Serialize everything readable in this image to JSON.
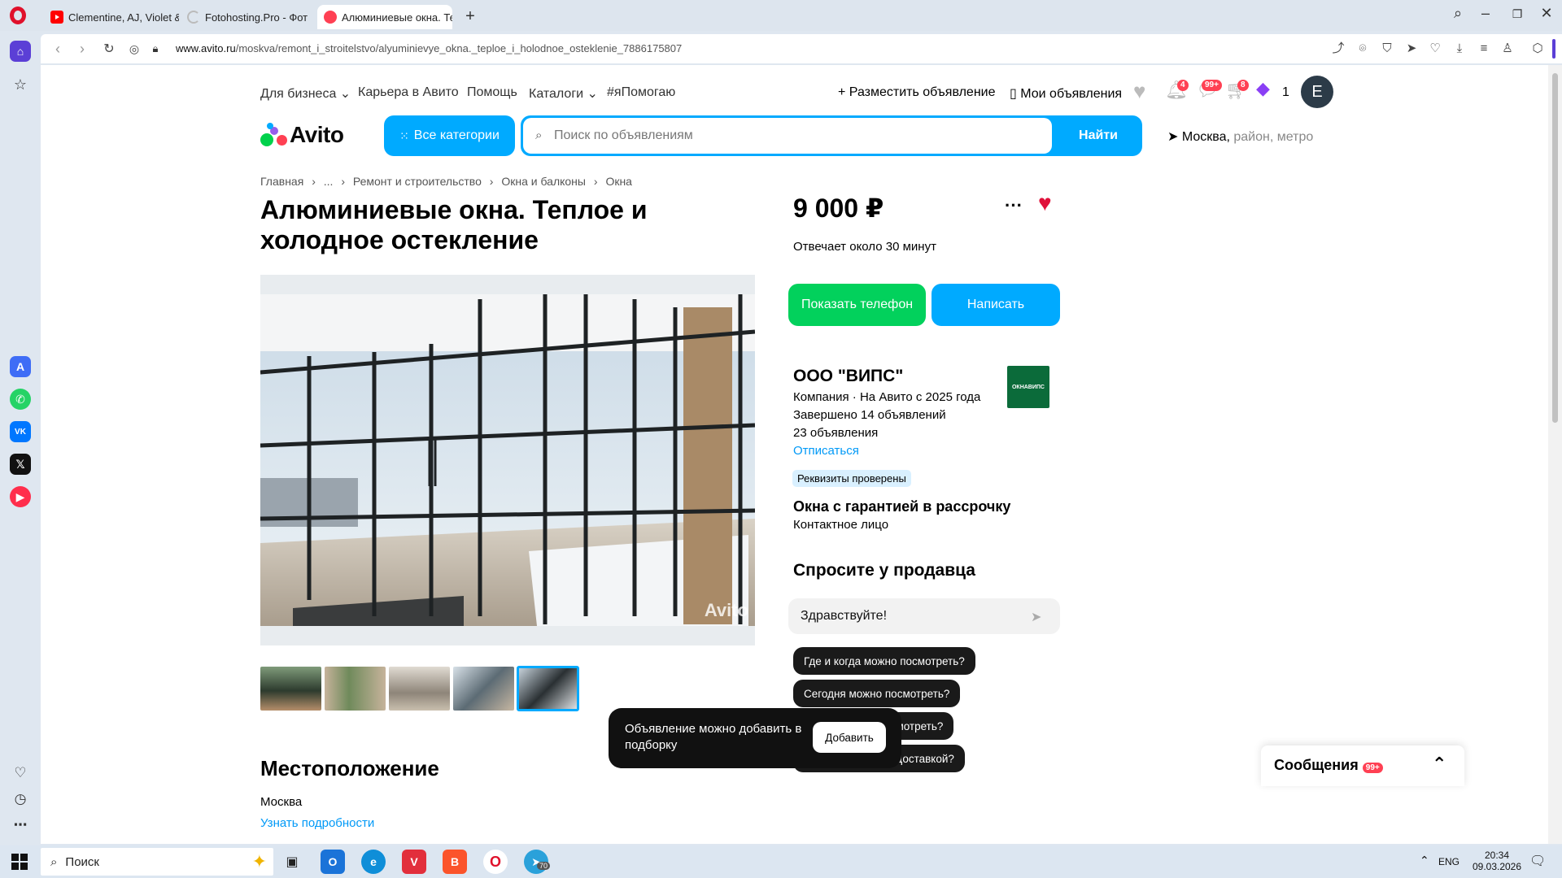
{
  "browser": {
    "tabs": [
      {
        "title": "Clementine, AJ, Violet & L",
        "active": false
      },
      {
        "title": "Fotohosting.Pro - Фот",
        "active": false
      },
      {
        "title": "Алюминиевые окна. Теп",
        "active": true
      }
    ],
    "url_domain": "www.avito.ru",
    "url_path": "/moskva/remont_i_stroitelstvo/alyuminievye_okna._teploe_i_holodnoe_osteklenie_7886175807"
  },
  "header": {
    "links": [
      "Для бизнеса",
      "Карьера в Авито",
      "Помощь",
      "Каталоги",
      "#яПомогаю"
    ],
    "post_ad": "Разместить объявление",
    "my_ads": "Мои объявления",
    "notif_count": "4",
    "messages_count": "99+",
    "cart_count": "8",
    "bonus_count": "1",
    "avatar_letter": "E",
    "logo_text": "Avito",
    "all_categories": "Все категории",
    "search_placeholder": "Поиск по объявлениям",
    "search_button": "Найти",
    "location_city": "Москва,",
    "location_hint": " район, метро"
  },
  "breadcrumbs": [
    "Главная",
    "›",
    "...",
    "›",
    "Ремонт и строительство",
    "›",
    "Окна и балконы",
    "›",
    "Окна"
  ],
  "listing": {
    "title": "Алюминиевые окна. Теплое и холодное остекление",
    "price": "9 000 ₽",
    "reply_time": "Отвечает около 30 минут",
    "show_phone": "Показать телефон",
    "write": "Написать",
    "watermark": "Avito"
  },
  "seller": {
    "name": "ООО \"ВИПС\"",
    "meta": "Компания · На Авито с 2025 года",
    "completed": "Завершено 14 объявлений",
    "ads": "23 объявления",
    "unsubscribe": "Отписаться",
    "verified": "Реквизиты проверены",
    "shop_name": "Окна с гарантией в рассрочку",
    "contact": "Контактное лицо",
    "logo_text": "ОКНАВИПС"
  },
  "ask": {
    "heading": "Спросите у продавца",
    "input_value": "Здравствуйте!",
    "questions": [
      "Где и когда можно посмотреть?",
      "Сегодня можно посмотреть?",
      "Завтра можно посмотреть?",
      "Отправите Авито Доставкой?"
    ]
  },
  "location": {
    "heading": "Местоположение",
    "city": "Москва",
    "details_link": "Узнать подробности"
  },
  "toast": {
    "message": "Объявление можно добавить в подборку",
    "button": "Добавить"
  },
  "messages_bar": {
    "label": "Сообщения",
    "count": "99+"
  },
  "taskbar": {
    "search_label": "Поиск",
    "lang": "ENG",
    "time": "20:34",
    "date": "09.03.2026",
    "telegram_badge": "70"
  },
  "colors": {
    "accent": "#00aaff",
    "green": "#02d15c",
    "red_badge": "#ff4053",
    "heart": "#e0113a"
  }
}
